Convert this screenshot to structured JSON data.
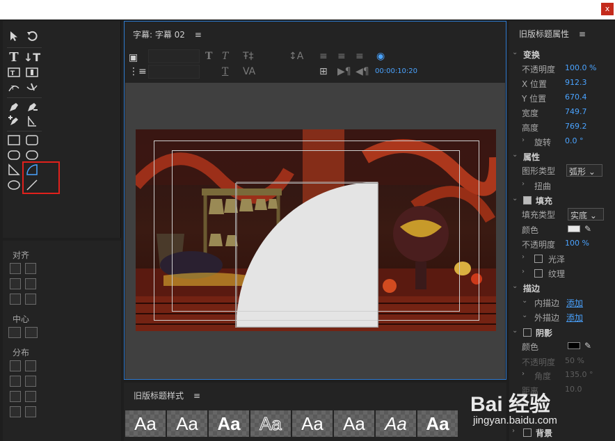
{
  "window": {
    "close_label": "x"
  },
  "align_panel": {
    "align_heading": "对齐",
    "center_heading": "中心",
    "distribute_heading": "分布"
  },
  "title_panel": {
    "tab_label": "字幕: 字幕 02",
    "timecode": "00:00:10:20"
  },
  "styles_panel": {
    "title": "旧版标题样式",
    "swatches": [
      "Aa",
      "Aa",
      "Aa",
      "Aa",
      "Aa",
      "Aa",
      "Aa",
      "Aa"
    ]
  },
  "properties": {
    "title": "旧版标题属性",
    "transform": {
      "heading": "变换",
      "opacity_label": "不透明度",
      "opacity_value": "100.0 %",
      "x_label": "X 位置",
      "x_value": "912.3",
      "y_label": "Y 位置",
      "y_value": "670.4",
      "width_label": "宽度",
      "width_value": "749.7",
      "height_label": "高度",
      "height_value": "769.2",
      "rotation_label": "旋转",
      "rotation_value": "0.0 °"
    },
    "attributes": {
      "heading": "属性",
      "shape_label": "图形类型",
      "shape_value": "弧形",
      "distort_label": "扭曲"
    },
    "fill": {
      "heading": "填充",
      "type_label": "填充类型",
      "type_value": "实底",
      "color_label": "颜色",
      "color_hex": "#e8e8e8",
      "opacity_label": "不透明度",
      "opacity_value": "100 %",
      "sheen_label": "光泽",
      "texture_label": "纹理"
    },
    "strokes": {
      "heading": "描边",
      "inner_label": "内描边",
      "inner_action": "添加",
      "outer_label": "外描边",
      "outer_action": "添加"
    },
    "shadow": {
      "heading": "阴影",
      "color_label": "颜色",
      "color_hex": "#000000",
      "opacity_label": "不透明度",
      "opacity_value": "50 %",
      "angle_label": "角度",
      "angle_value": "135.0 °",
      "distance_label": "距离",
      "distance_value": "10.0"
    },
    "background": {
      "heading": "背景"
    }
  },
  "watermark": {
    "logo": "Bai 经验",
    "url": "jingyan.baidu.com"
  }
}
